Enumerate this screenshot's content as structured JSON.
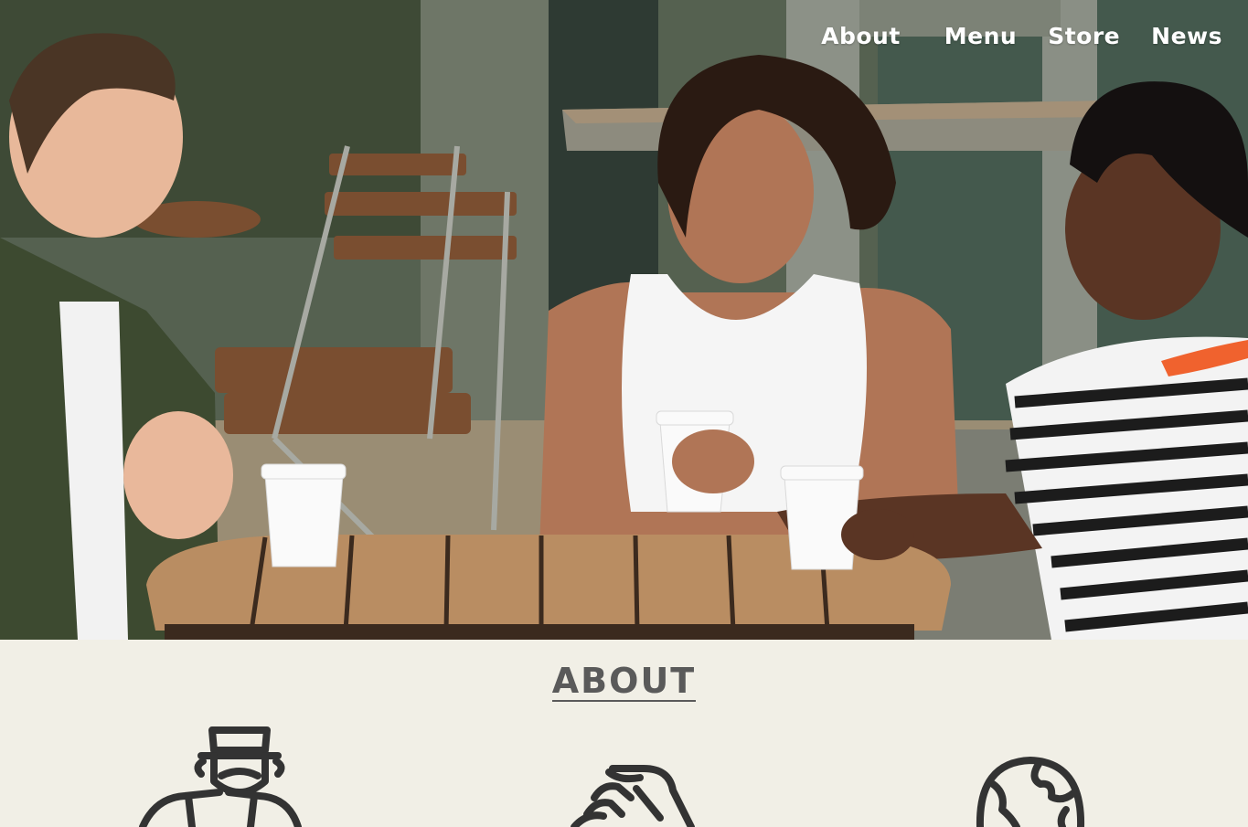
{
  "nav": {
    "items": [
      {
        "label": "About"
      },
      {
        "label": "Menu"
      },
      {
        "label": "Store"
      },
      {
        "label": "News"
      }
    ]
  },
  "hero": {
    "image_description_icon": "coffee-friends-photo"
  },
  "about": {
    "title": "ABOUT",
    "icons": [
      "barista-icon",
      "handshake-icon",
      "globe-icon"
    ]
  },
  "colors": {
    "background": "#f1efe6",
    "title": "#5a5a5a",
    "icon_stroke": "#333333",
    "nav_text": "#ffffff"
  }
}
